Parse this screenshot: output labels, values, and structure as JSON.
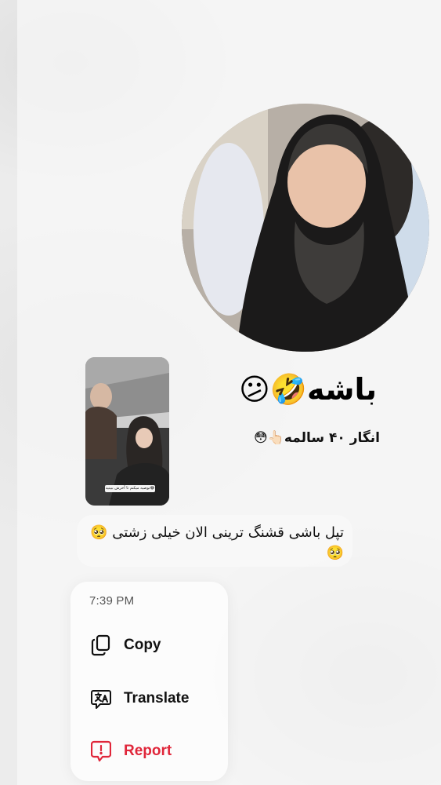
{
  "story": {
    "title": "باشه🤣😕",
    "subtitle": "انگار ۴۰ سالمه👆🏻😳",
    "thumbnail_caption": "توصیه میکنم تا آخرش ببینید😂"
  },
  "message": {
    "text": "تپل باشی قشنگ ترینی الان خیلی زشتی 🥺🥺"
  },
  "context_menu": {
    "time": "7:39 PM",
    "items": [
      {
        "label": "Copy",
        "icon": "copy-icon"
      },
      {
        "label": "Translate",
        "icon": "translate-icon"
      },
      {
        "label": "Report",
        "icon": "report-icon"
      }
    ]
  },
  "colors": {
    "report": "#e0263a",
    "text": "#111111",
    "menu_background": "#fcfcfc"
  }
}
